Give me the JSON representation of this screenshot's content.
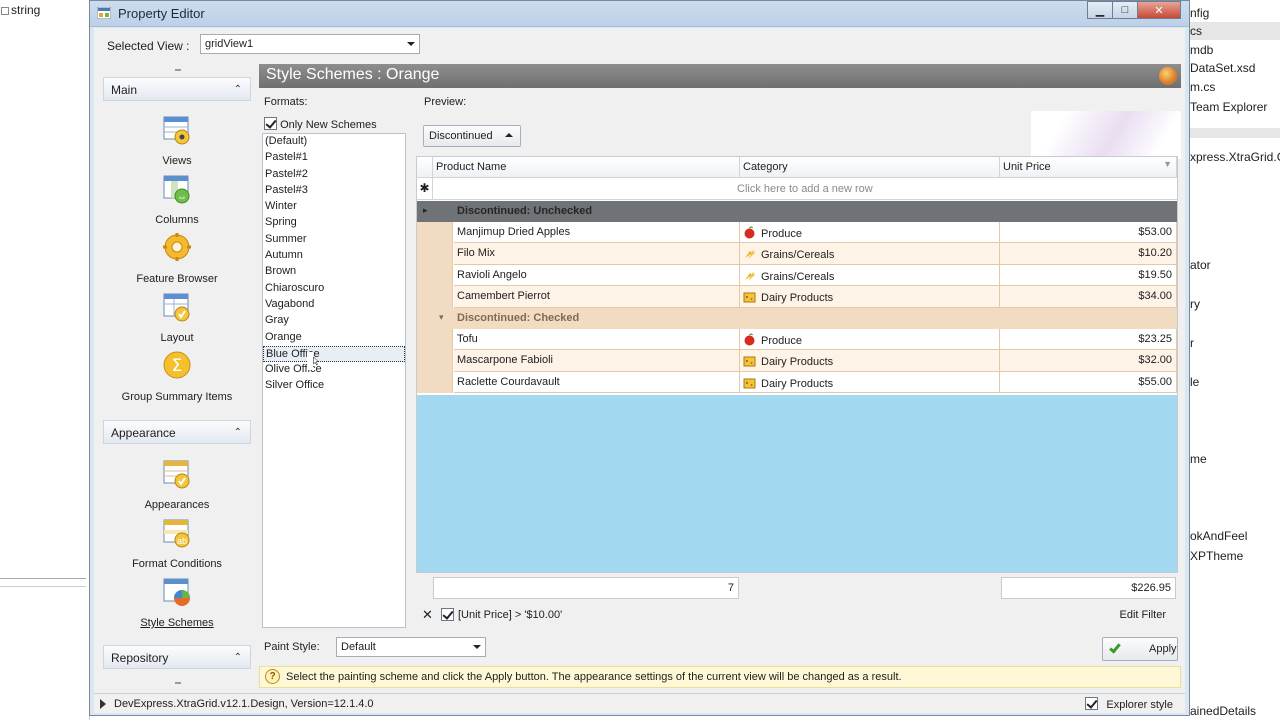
{
  "background": {
    "code_text": "string",
    "right_panel_items": [
      "nfig",
      "cs",
      "mdb",
      "DataSet.xsd",
      "m.cs",
      "Team Explorer",
      "xpress.XtraGrid.C",
      "ator",
      "ry",
      "r",
      "le",
      "me",
      "okAndFeel",
      "XPTheme",
      "ainedDetails"
    ]
  },
  "window": {
    "title": "Property Editor",
    "minimize_glyph": "▁",
    "maximize_glyph": "□",
    "close_glyph": "✕"
  },
  "selected_view": {
    "label": "Selected View :",
    "value": "gridView1"
  },
  "nav": {
    "groups": {
      "main": "Main",
      "appearance": "Appearance",
      "repository": "Repository"
    },
    "chevron": "⌃",
    "items": {
      "views": "Views",
      "columns": "Columns",
      "feature_browser": "Feature Browser",
      "layout": "Layout",
      "group_summary": "Group Summary Items",
      "appearances": "Appearances",
      "format_conditions": "Format Conditions",
      "style_schemes": "Style Schemes"
    }
  },
  "header": {
    "title": "Style Schemes : Orange"
  },
  "formats": {
    "title": "Formats:",
    "only_new_label": "Only New Schemes",
    "items": [
      "(Default)",
      "Pastel#1",
      "Pastel#2",
      "Pastel#3",
      "Winter",
      "Spring",
      "Summer",
      "Autumn",
      "Brown",
      "Chiaroscuro",
      "Vagabond",
      "Gray",
      "Orange",
      "Blue Office",
      "Olive Office",
      "Silver Office"
    ],
    "hot_item": "Blue Office"
  },
  "preview": {
    "title": "Preview:",
    "group_button": "Discontinued",
    "columns": [
      "Product Name",
      "Category",
      "Unit Price"
    ],
    "new_row_text": "Click here to add a new row",
    "new_row_glyph": "✱",
    "groups": [
      {
        "label": "Discontinued: Unchecked",
        "glyph": "▸",
        "rows": [
          {
            "name": "Manjimup Dried Apples",
            "category": "Produce",
            "price": "$53.00"
          },
          {
            "name": "Filo Mix",
            "category": "Grains/Cereals",
            "price": "$10.20"
          },
          {
            "name": "Ravioli Angelo",
            "category": "Grains/Cereals",
            "price": "$19.50"
          },
          {
            "name": "Camembert Pierrot",
            "category": "Dairy Products",
            "price": "$34.00"
          }
        ]
      },
      {
        "label": "Discontinued: Checked",
        "glyph": "▾",
        "rows": [
          {
            "name": "Tofu",
            "category": "Produce",
            "price": "$23.25"
          },
          {
            "name": "Mascarpone Fabioli",
            "category": "Dairy Products",
            "price": "$32.00"
          },
          {
            "name": "Raclette Courdavault",
            "category": "Dairy Products",
            "price": "$55.00"
          }
        ]
      }
    ],
    "footer_count": "7",
    "footer_total": "$226.95",
    "filter_close": "✕",
    "filter_expression": "[Unit Price] > '$10.00'",
    "edit_filter": "Edit Filter"
  },
  "paint_style": {
    "label": "Paint Style:",
    "value": "Default"
  },
  "apply_button": "Apply",
  "hint_glyph": "?",
  "hint_text": "Select the painting scheme and click the Apply button. The appearance settings of the current view will be changed as a result.",
  "status": {
    "text": "DevExpress.XtraGrid.v12.1.Design, Version=12.1.4.0",
    "explorer_style": "Explorer style"
  },
  "colors": {
    "header_bg": "#7d7d7d",
    "group_dark": "#6f7276",
    "group_light": "#f2dcc1",
    "empty_area": "#a3d8f1"
  }
}
